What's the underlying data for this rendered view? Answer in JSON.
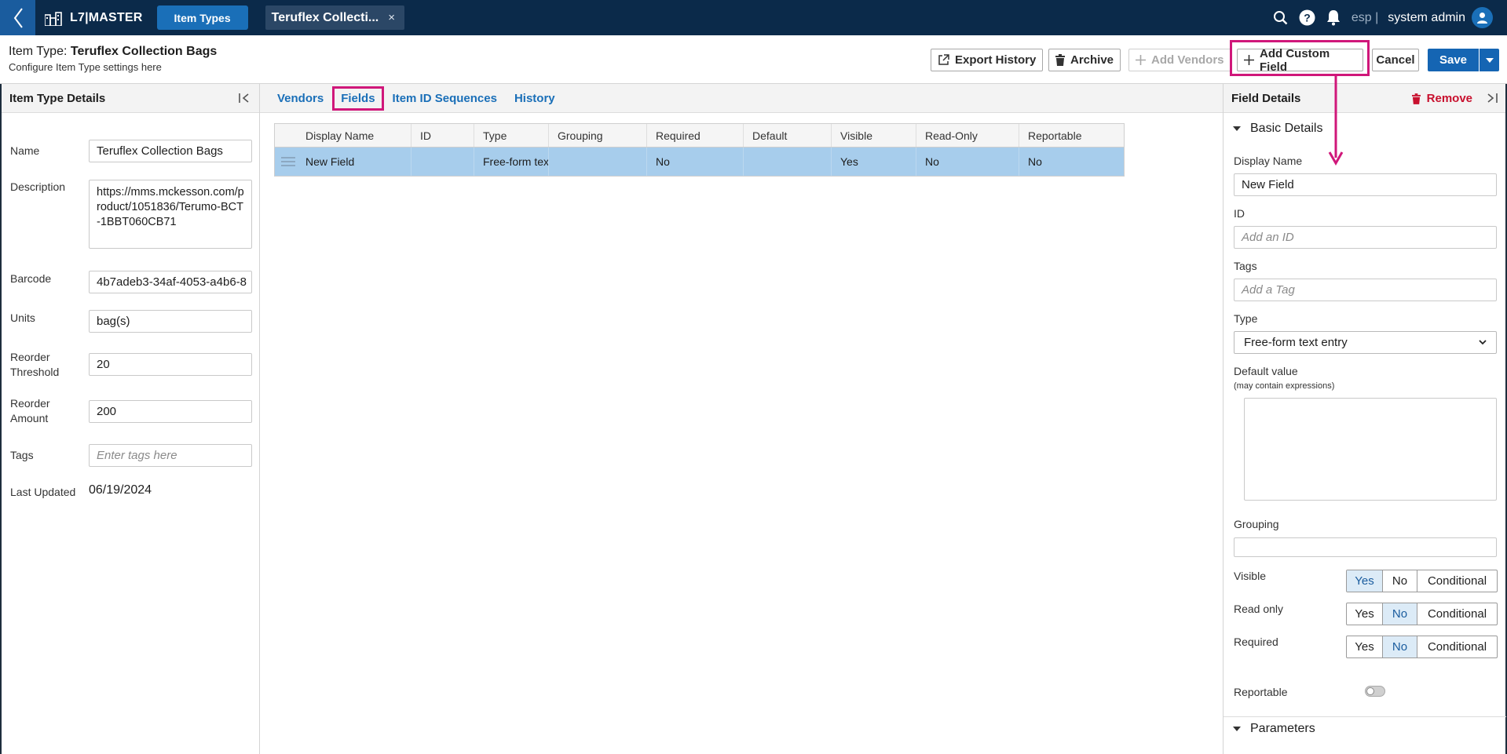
{
  "topbar": {
    "brand": "L7|MASTER",
    "nav_pill": "Item Types",
    "doc_tab": "Teruflex Collecti...",
    "doc_tab_close": "×",
    "lang": "esp |",
    "user": "system admin"
  },
  "header": {
    "title_prefix": "Item Type: ",
    "title_name": "Teruflex Collection Bags",
    "subtitle": "Configure Item Type settings here",
    "buttons": {
      "export_history": "Export History",
      "archive": "Archive",
      "add_vendors": "Add Vendors",
      "add_custom_field": "Add Custom Field",
      "cancel": "Cancel",
      "save": "Save"
    }
  },
  "left": {
    "title": "Item Type Details",
    "fields": {
      "name_label": "Name",
      "name_value": "Teruflex Collection Bags",
      "description_label": "Description",
      "description_value": "https://mms.mckesson.com/product/1051836/Terumo-BCT-1BBT060CB71",
      "barcode_label": "Barcode",
      "barcode_value": "4b7adeb3-34af-4053-a4b6-8",
      "units_label": "Units",
      "units_value": "bag(s)",
      "reorder_threshold_label_1": "Reorder",
      "reorder_threshold_label_2": "Threshold",
      "reorder_threshold_value": "20",
      "reorder_amount_label_1": "Reorder",
      "reorder_amount_label_2": "Amount",
      "reorder_amount_value": "200",
      "tags_label": "Tags",
      "tags_placeholder": "Enter tags here",
      "last_updated_label": "Last Updated",
      "last_updated_value": "06/19/2024"
    }
  },
  "center": {
    "tabs": [
      "Vendors",
      "Fields",
      "Item ID Sequences",
      "History"
    ],
    "columns": [
      "Display Name",
      "ID",
      "Type",
      "Grouping",
      "Required",
      "Default",
      "Visible",
      "Read-Only",
      "Reportable"
    ],
    "rows": [
      {
        "display_name": "New Field",
        "id": "",
        "type": "Free-form tex",
        "grouping": "",
        "required": "No",
        "default": "",
        "visible": "Yes",
        "read_only": "No",
        "reportable": "No"
      }
    ]
  },
  "right": {
    "title": "Field Details",
    "remove": "Remove",
    "basic_details": "Basic Details",
    "display_name_label": "Display Name",
    "display_name_value": "New Field",
    "id_label": "ID",
    "id_placeholder": "Add an ID",
    "tags_label": "Tags",
    "tags_placeholder": "Add a Tag",
    "type_label": "Type",
    "type_value": "Free-form text entry",
    "default_label": "Default value",
    "default_hint": "(may contain expressions)",
    "grouping_label": "Grouping",
    "visible_label": "Visible",
    "read_only_label": "Read only",
    "required_label": "Required",
    "seg_yes": "Yes",
    "seg_no": "No",
    "seg_conditional": "Conditional",
    "visible_selected": "Yes",
    "read_only_selected": "No",
    "required_selected": "No",
    "reportable_label": "Reportable",
    "reportable_on": false,
    "parameters": "Parameters"
  },
  "colors": {
    "topbar": "#0b2a4a",
    "accent": "#1a6fb8",
    "highlight": "#d0177a",
    "danger": "#c8102e",
    "row_selected": "#a7cdec"
  }
}
